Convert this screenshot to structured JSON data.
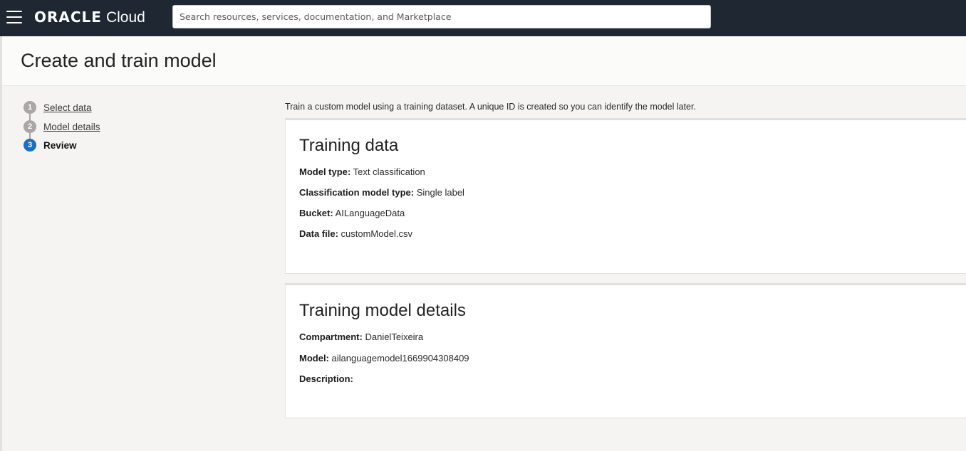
{
  "header": {
    "brand": "ORACLE",
    "product": "Cloud",
    "search_placeholder": "Search resources, services, documentation, and Marketplace"
  },
  "page": {
    "title": "Create and train model"
  },
  "steps": [
    {
      "number": "1",
      "label": "Select data"
    },
    {
      "number": "2",
      "label": "Model details"
    },
    {
      "number": "3",
      "label": "Review"
    }
  ],
  "intro": "Train a custom model using a training dataset. A unique ID is created so you can identify the model later.",
  "training_data": {
    "heading": "Training data",
    "fields": [
      {
        "label": "Model type:",
        "value": "Text classification"
      },
      {
        "label": "Classification model type:",
        "value": "Single label"
      },
      {
        "label": "Bucket:",
        "value": "AILanguageData"
      },
      {
        "label": "Data file:",
        "value": "customModel.csv"
      }
    ]
  },
  "training_model_details": {
    "heading": "Training model details",
    "fields": [
      {
        "label": "Compartment:",
        "value": "DanielTeixeira"
      },
      {
        "label": "Model:",
        "value": "ailanguagemodel1669904308409"
      },
      {
        "label": "Description:",
        "value": ""
      }
    ]
  },
  "colors": {
    "topbar": "#1f2733",
    "active_step": "#1a6fc4",
    "inactive_step": "#a9a6a3"
  }
}
